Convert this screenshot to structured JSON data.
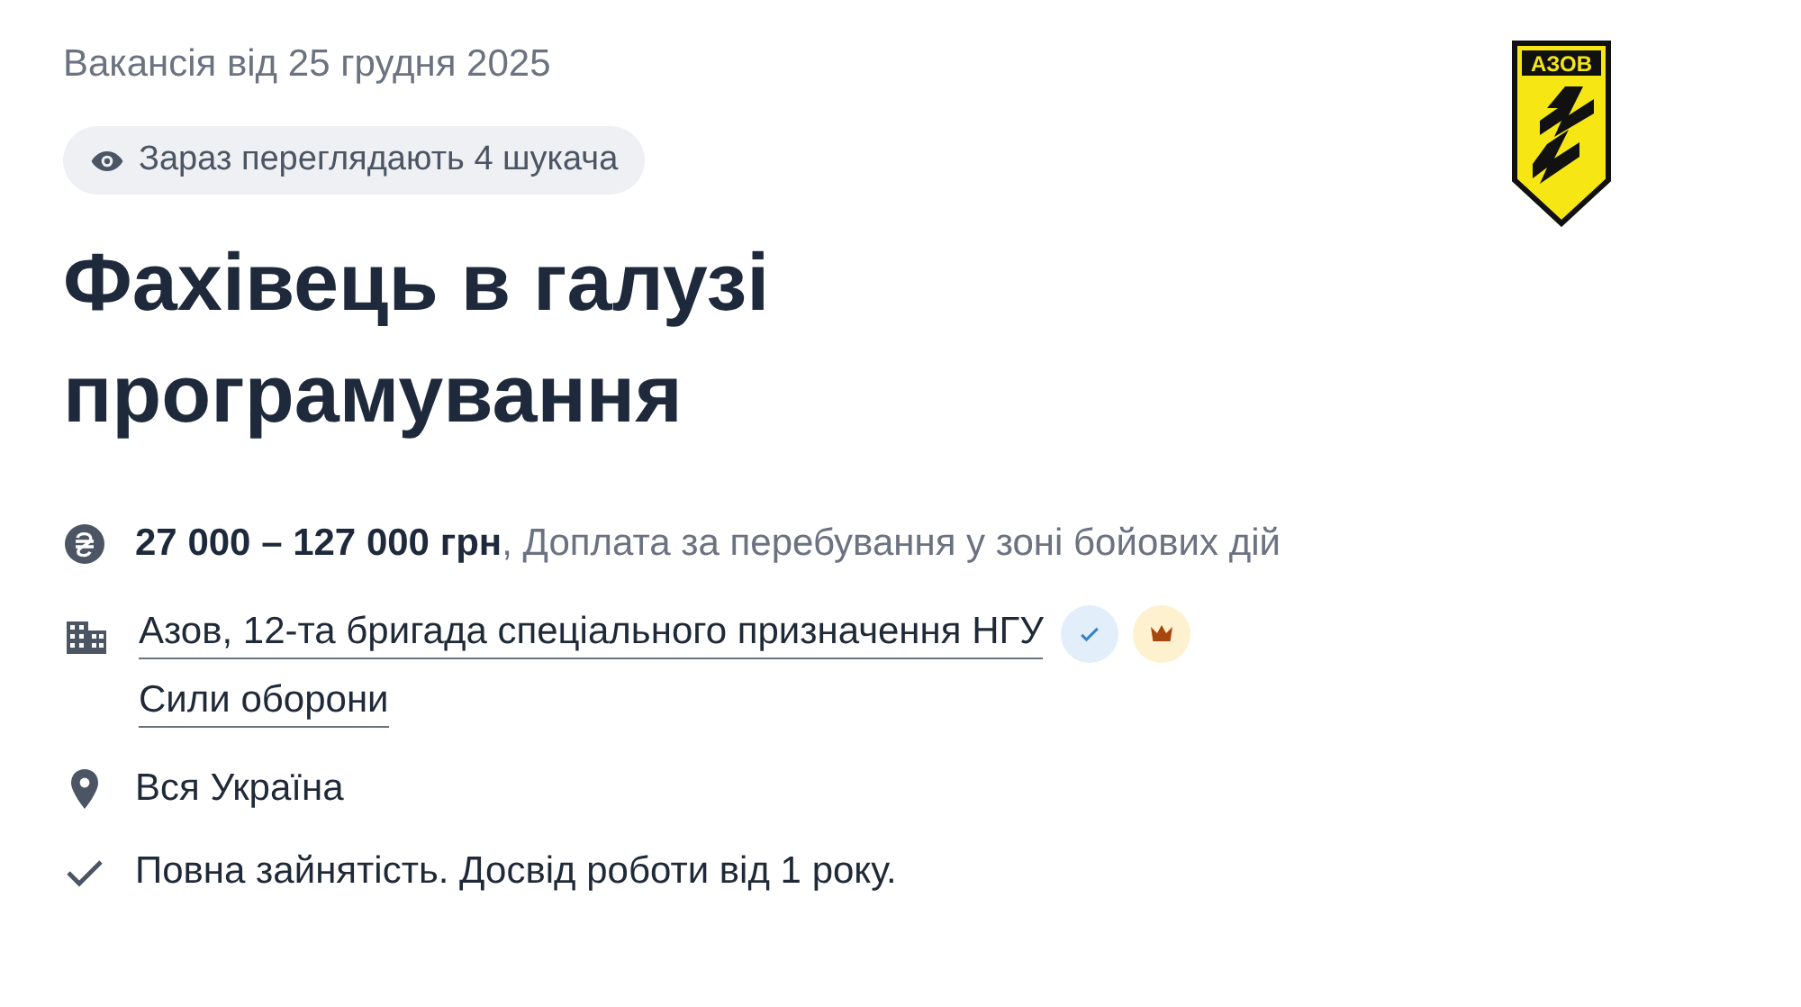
{
  "posted": "Вакансія від 25 грудня 2025",
  "viewers": "Зараз переглядають 4 шукача",
  "title": "Фахівець в галузі програмування",
  "logo": {
    "text": "АЗОВ"
  },
  "salary": "**27 000 – 127 000 грн**, Доплата за перебування у зоні бойових дій",
  "company": {
    "name": "Азов, 12-та бригада спеціального призначення НГУ",
    "verified": true,
    "premium": true
  },
  "category": "Сили оборони",
  "location": "Вся Україна",
  "employment": "Повна зайнятість. Досвід роботи від 1 року."
}
